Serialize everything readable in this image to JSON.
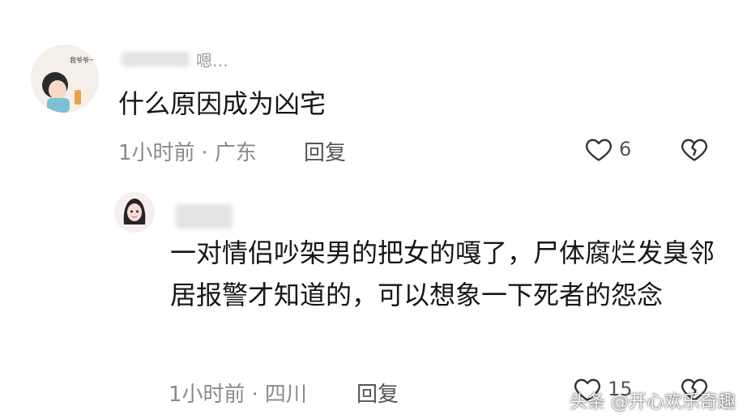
{
  "comments": [
    {
      "username": "嗯…",
      "text": "什么原因成为凶宅",
      "time": "1小时前",
      "location": "广东",
      "reply_label": "回复",
      "likes": "6",
      "avatar_caption": "我爷爷一生"
    },
    {
      "username": "",
      "text": "一对情侣吵架男的把女的嘎了，尸体腐烂发臭邻居报警才知道的，可以想象一下死者的怨念",
      "time": "1小时前",
      "location": "四川",
      "reply_label": "回复",
      "likes": "15"
    }
  ],
  "meta_separator": "·",
  "watermark": "头条 @开心欢乐奇趣",
  "colors": {
    "meta": "#8a8a8a",
    "text": "#161616",
    "icon": "#333333"
  },
  "icons": {
    "like": "heart-icon",
    "dislike": "broken-heart-icon"
  }
}
